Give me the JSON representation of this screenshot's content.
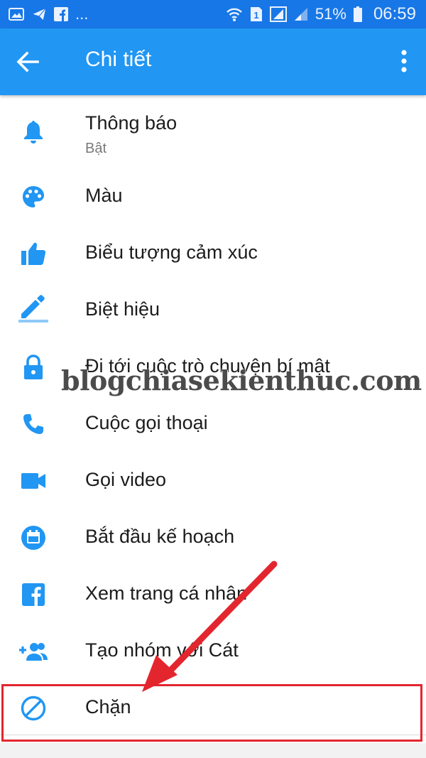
{
  "status_bar": {
    "left_icons": [
      "image-icon",
      "send-icon",
      "facebook-icon"
    ],
    "ellipsis": "...",
    "battery": "51%",
    "time": "06:59",
    "sim_label": "1"
  },
  "app_bar": {
    "title": "Chi tiết"
  },
  "menu": {
    "items": [
      {
        "label": "Thông báo",
        "sub": "Bật",
        "icon": "bell-icon"
      },
      {
        "label": "Màu",
        "icon": "palette-icon"
      },
      {
        "label": "Biểu tượng cảm xúc",
        "icon": "thumbs-up-icon"
      },
      {
        "label": "Biệt hiệu",
        "icon": "pencil-icon"
      },
      {
        "label": "Đi tới cuộc trò chuyện bí mật",
        "icon": "lock-icon"
      },
      {
        "label": "Cuộc gọi thoại",
        "icon": "phone-icon"
      },
      {
        "label": "Gọi video",
        "icon": "video-camera-icon"
      },
      {
        "label": "Bắt đầu kế hoạch",
        "icon": "calendar-icon"
      },
      {
        "label": "Xem trang cá nhân",
        "icon": "facebook-icon"
      },
      {
        "label": "Tạo nhóm với Cát",
        "icon": "add-group-icon"
      },
      {
        "label": "Chặn",
        "icon": "block-icon"
      }
    ]
  },
  "watermark": "blogchiasekienthuc.com",
  "colors": {
    "status_bar": "#1877e6",
    "app_bar": "#2196f3",
    "icon_blue": "#2196f3",
    "highlight": "#e3262e"
  }
}
